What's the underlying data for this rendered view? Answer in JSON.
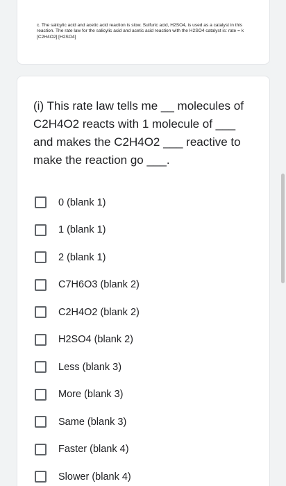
{
  "context": {
    "text": "c. The salicylic acid and acetic acid reaction is slow. Sulfuric acid, H2SO4, is used as a catalyst in this reaction. The rate law for the salicylic acid and acetic acid reaction with the H2SO4 catalyst is: rate = k [C2H4O2] [H2SO4]"
  },
  "question": {
    "text": "(i) This rate law tells me __ molecules of\nC2H4O2 reacts with 1 molecule of ___\nand makes the C2H4O2 ___ reactive to\nmake the reaction go ___."
  },
  "options": [
    {
      "label": "0 (blank 1)"
    },
    {
      "label": "1 (blank 1)"
    },
    {
      "label": "2 (blank 1)"
    },
    {
      "label": "C7H6O3 (blank 2)"
    },
    {
      "label": "C2H4O2 (blank 2)"
    },
    {
      "label": "H2SO4 (blank 2)"
    },
    {
      "label": "Less (blank 3)"
    },
    {
      "label": "More (blank 3)"
    },
    {
      "label": "Same (blank 3)"
    },
    {
      "label": "Faster (blank 4)"
    },
    {
      "label": "Slower (blank 4)"
    }
  ]
}
